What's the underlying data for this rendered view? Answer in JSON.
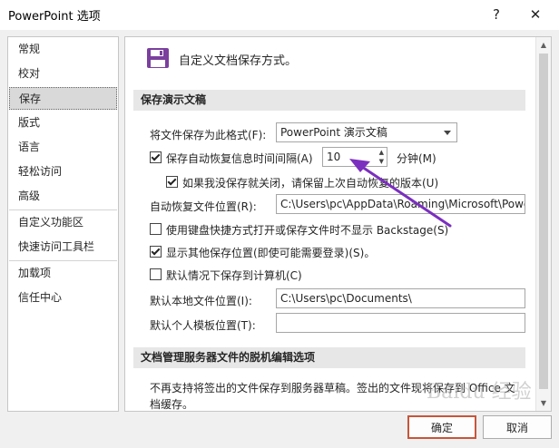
{
  "window": {
    "title": "PowerPoint 选项",
    "help_glyph": "?",
    "close_glyph": "✕"
  },
  "sidebar": {
    "items": [
      {
        "label": "常规"
      },
      {
        "label": "校对"
      },
      {
        "label": "保存",
        "selected": true
      },
      {
        "label": "版式"
      },
      {
        "label": "语言"
      },
      {
        "label": "轻松访问"
      },
      {
        "label": "高级"
      },
      {
        "label": "自定义功能区"
      },
      {
        "label": "快速访问工具栏"
      },
      {
        "label": "加载项"
      },
      {
        "label": "信任中心"
      }
    ]
  },
  "main": {
    "heading": "自定义文档保存方式。",
    "section_save": {
      "title": "保存演示文稿",
      "format_label": "将文件保存为此格式(F):",
      "format_value": "PowerPoint 演示文稿",
      "autorecover_label": "保存自动恢复信息时间间隔(A)",
      "autorecover_checked": true,
      "autorecover_minutes": "10",
      "minutes_label": "分钟(M)",
      "keep_last_label": "如果我没保存就关闭，请保留上次自动恢复的版本(U)",
      "keep_last_checked": true,
      "autorecover_location_label": "自动恢复文件位置(R):",
      "autorecover_location_value": "C:\\Users\\pc\\AppData\\Roaming\\Microsoft\\PowerPoint\\",
      "no_backstage_label": "使用键盘快捷方式打开或保存文件时不显示 Backstage(S)",
      "no_backstage_checked": false,
      "show_other_label": "显示其他保存位置(即使可能需要登录)(S)。",
      "show_other_checked": true,
      "default_computer_label": "默认情况下保存到计算机(C)",
      "default_computer_checked": false,
      "local_location_label": "默认本地文件位置(I):",
      "local_location_value": "C:\\Users\\pc\\Documents\\",
      "template_location_label": "默认个人模板位置(T):",
      "template_location_value": ""
    },
    "section_offline": {
      "title": "文档管理服务器文件的脱机编辑选项",
      "text_line1": "不再支持将签出的文件保存到服务器草稿。签出的文件现将保存到 Office 文",
      "text_line2": "档缓存。"
    }
  },
  "buttons": {
    "ok": "确定",
    "cancel": "取消"
  },
  "watermark": "Baidu 经验",
  "colors": {
    "annotation_arrow": "#7b2fbf",
    "ok_border": "#c8553a",
    "save_icon": "#7b3f9e"
  }
}
